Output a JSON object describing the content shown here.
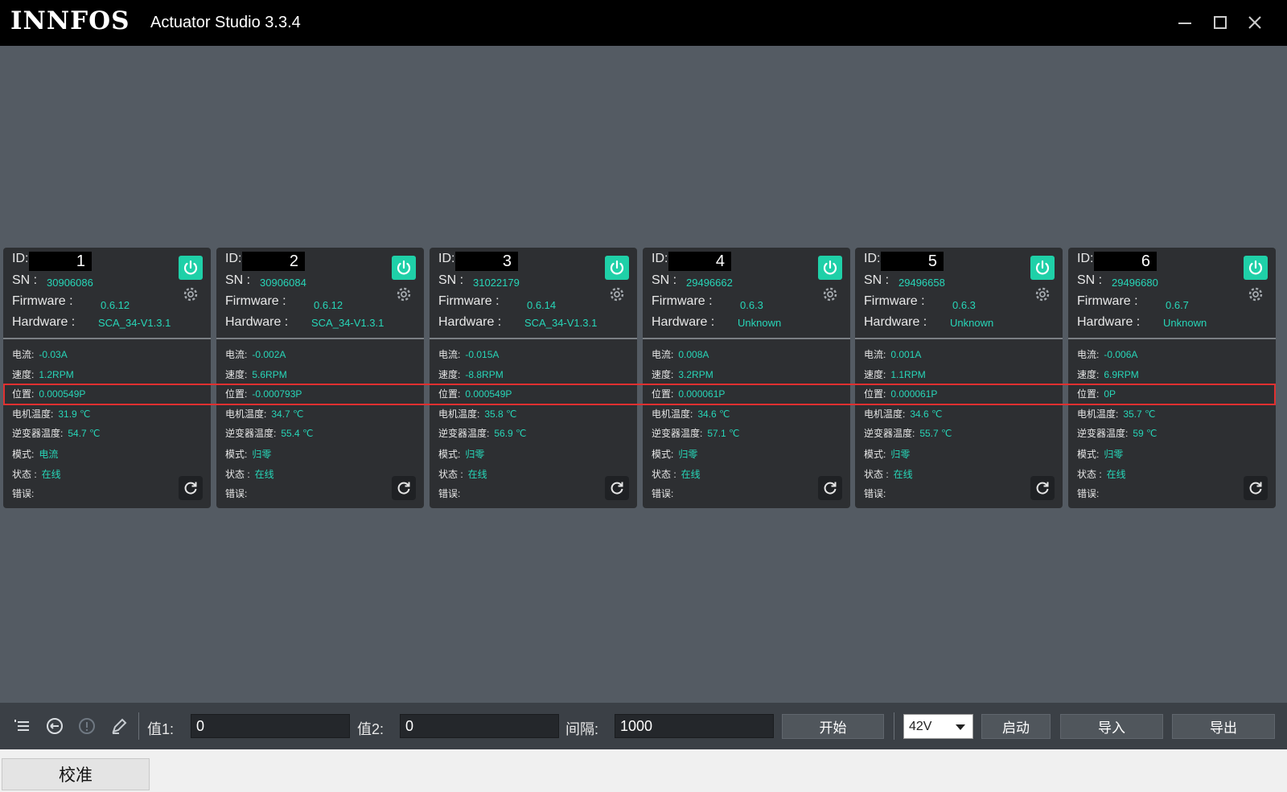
{
  "app": {
    "logo": "INNFOS",
    "title": "Actuator Studio 3.3.4"
  },
  "labels": {
    "id": "ID:",
    "sn": "SN :",
    "firmware": "Firmware :",
    "hardware": "Hardware :",
    "current": "电流:",
    "speed": "速度:",
    "position": "位置:",
    "motor_temp": "电机温度:",
    "inverter_temp": "逆变器温度:",
    "mode": "模式:",
    "status": "状态 :",
    "error": "错误:"
  },
  "actuators": [
    {
      "id": "1",
      "sn": "30906086",
      "firmware": "0.6.12",
      "hardware": "SCA_34-V1.3.1",
      "current": "-0.03A",
      "speed": "1.2RPM",
      "position": "0.000549P",
      "motor_temp": "31.9 ℃",
      "inverter_temp": "54.7 ℃",
      "mode": "电流",
      "status": "在线",
      "error": ""
    },
    {
      "id": "2",
      "sn": "30906084",
      "firmware": "0.6.12",
      "hardware": "SCA_34-V1.3.1",
      "current": "-0.002A",
      "speed": "5.6RPM",
      "position": "-0.000793P",
      "motor_temp": "34.7 ℃",
      "inverter_temp": "55.4 ℃",
      "mode": "归零",
      "status": "在线",
      "error": ""
    },
    {
      "id": "3",
      "sn": "31022179",
      "firmware": "0.6.14",
      "hardware": "SCA_34-V1.3.1",
      "current": "-0.015A",
      "speed": "-8.8RPM",
      "position": "0.000549P",
      "motor_temp": "35.8 ℃",
      "inverter_temp": "56.9 ℃",
      "mode": "归零",
      "status": "在线",
      "error": ""
    },
    {
      "id": "4",
      "sn": "29496662",
      "firmware": "0.6.3",
      "hardware": "Unknown",
      "current": "0.008A",
      "speed": "3.2RPM",
      "position": "0.000061P",
      "motor_temp": "34.6 ℃",
      "inverter_temp": "57.1 ℃",
      "mode": "归零",
      "status": "在线",
      "error": ""
    },
    {
      "id": "5",
      "sn": "29496658",
      "firmware": "0.6.3",
      "hardware": "Unknown",
      "current": "0.001A",
      "speed": "1.1RPM",
      "position": "0.000061P",
      "motor_temp": "34.6 ℃",
      "inverter_temp": "55.7 ℃",
      "mode": "归零",
      "status": "在线",
      "error": ""
    },
    {
      "id": "6",
      "sn": "29496680",
      "firmware": "0.6.7",
      "hardware": "Unknown",
      "current": "-0.006A",
      "speed": "6.9RPM",
      "position": "0P",
      "motor_temp": "35.7 ℃",
      "inverter_temp": "59 ℃",
      "mode": "归零",
      "status": "在线",
      "error": ""
    }
  ],
  "toolbar": {
    "value1_label": "值1:",
    "value1": "0",
    "value2_label": "值2:",
    "value2": "0",
    "interval_label": "间隔:",
    "interval": "1000",
    "start_button": "开始",
    "voltage_selected": "42V",
    "launch_button": "启动",
    "import_button": "导入",
    "export_button": "导出"
  },
  "calibrate_button": "校准",
  "colors": {
    "accent": "#1fd0a8",
    "value_text": "#27d6b8",
    "highlight": "#e03030"
  }
}
